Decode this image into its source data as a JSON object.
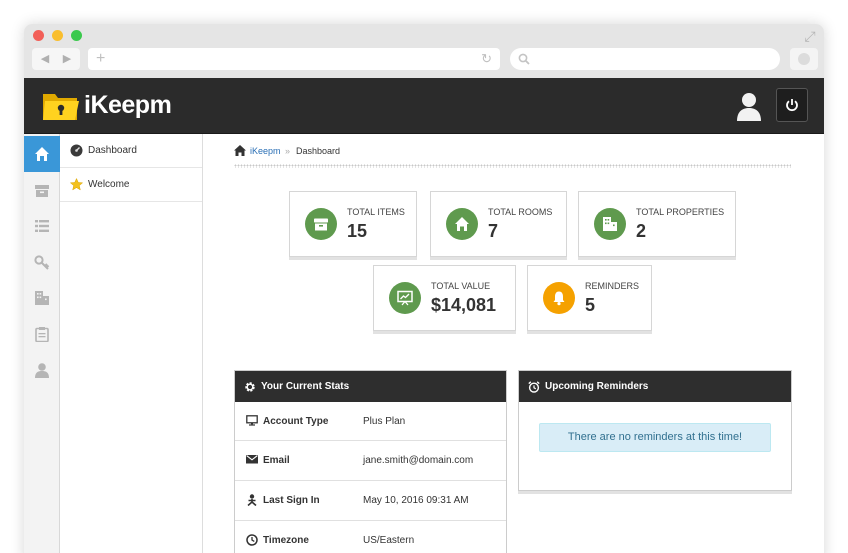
{
  "app": {
    "name": "iKeepm"
  },
  "sidebar": {
    "rail": [
      "home-icon",
      "box-icon",
      "list-icon",
      "key-icon",
      "building-icon",
      "clipboard-icon",
      "user-icon"
    ],
    "items": [
      {
        "label": "Dashboard",
        "icon": "dashboard-icon"
      },
      {
        "label": "Welcome",
        "icon": "star-icon"
      }
    ]
  },
  "breadcrumb": {
    "home": "iKeepm",
    "separator": "»",
    "current": "Dashboard"
  },
  "stats": [
    {
      "label": "TOTAL ITEMS",
      "value": "15",
      "icon": "box-icon",
      "color": "#5f9a4e"
    },
    {
      "label": "TOTAL ROOMS",
      "value": "7",
      "icon": "house-icon",
      "color": "#5f9a4e"
    },
    {
      "label": "TOTAL PROPERTIES",
      "value": "2",
      "icon": "building-icon",
      "color": "#5f9a4e"
    },
    {
      "label": "TOTAL VALUE",
      "value": "$14,081",
      "icon": "chart-board-icon",
      "color": "#5f9a4e"
    },
    {
      "label": "REMINDERS",
      "value": "5",
      "icon": "bell-icon",
      "color": "#f5a100"
    }
  ],
  "current_stats": {
    "title": "Your Current Stats",
    "rows": [
      {
        "key": "Account Type",
        "value": "Plus Plan",
        "icon": "monitor-icon"
      },
      {
        "key": "Email",
        "value": "jane.smith@domain.com",
        "icon": "envelope-icon"
      },
      {
        "key": "Last Sign In",
        "value": "May 10, 2016 09:31 AM",
        "icon": "sign-in-icon"
      },
      {
        "key": "Timezone",
        "value": "US/Eastern",
        "icon": "clock-icon"
      }
    ]
  },
  "reminders": {
    "title": "Upcoming Reminders",
    "empty_message": "There are no reminders at this time!"
  },
  "colors": {
    "accent": "#3a97d8",
    "header_bg": "#2b2b2b",
    "stat_green": "#5f9a4e",
    "stat_orange": "#f5a100",
    "link": "#2a6fb5"
  }
}
